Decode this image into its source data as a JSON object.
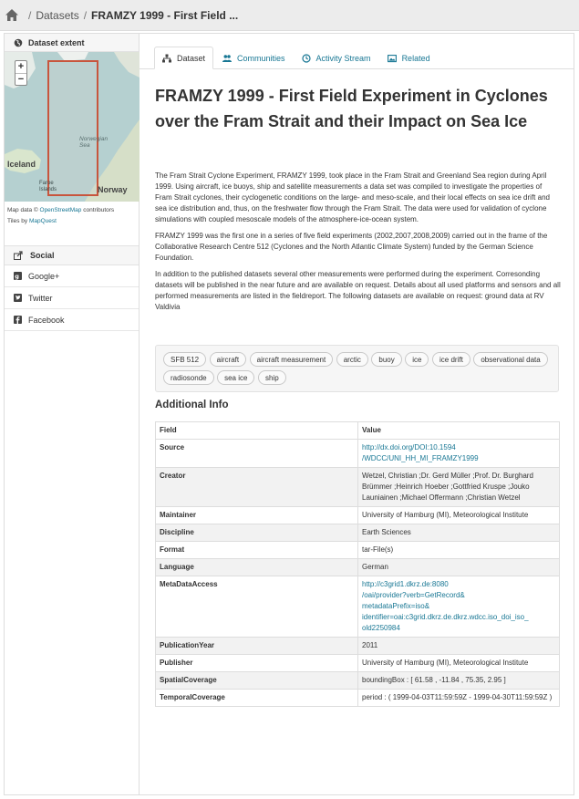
{
  "breadcrumb": {
    "items": [
      "Datasets"
    ],
    "current": "FRAMZY 1999 - First Field ..."
  },
  "sidebar": {
    "extent_title": "Dataset extent",
    "map": {
      "zoom_in": "+",
      "zoom_out": "−",
      "labels": {
        "iceland": "Iceland",
        "norway": "Norway",
        "faroe": "Faroe Islands",
        "sea": "Norwegian Sea"
      },
      "attribution_prefix": "Map data ©",
      "attribution_link": "OpenStreetMap",
      "attribution_suffix": "contributors",
      "tiles_prefix": "Tiles by",
      "tiles_link": "MapQuest"
    },
    "social_title": "Social",
    "social_items": [
      "Google+",
      "Twitter",
      "Facebook"
    ]
  },
  "tabs": [
    "Dataset",
    "Communities",
    "Activity Stream",
    "Related"
  ],
  "dataset": {
    "title": "FRAMZY 1999 - First Field Experiment in Cyclones over the Fram Strait and their Impact on Sea Ice",
    "paragraphs": [
      "The Fram Strait Cyclone Experiment, FRAMZY 1999, took place in the Fram Strait and Greenland Sea region during April 1999. Using aircraft, ice buoys, ship and satellite measurements a data set was compiled to investigate the properties of Fram Strait cyclones, their cyclogenetic conditions on the large- and meso-scale, and their local effects on sea ice drift and sea ice distribution and, thus, on the freshwater flow through the Fram Strait. The data were used for validation of cyclone simulations with coupled mesoscale models of the atmosphere-ice-ocean system.",
      "FRAMZY 1999 was the first one in a series of five field experiments (2002,2007,2008,2009) carried out in the frame of the Collaborative Research Centre 512 (Cyclones and the North Atlantic Climate System) funded by the German Science Foundation.",
      "In addition to the published datasets several other measurements were performed during the experiment. Corresonding datasets will be published in the near future and are available on request. Details about all used platforms and sensors and all performed measurements are listed in the fieldreport. The following datasets are available on request: ground data at RV Valdivia"
    ],
    "tags": [
      "SFB 512",
      "aircraft",
      "aircraft measurement",
      "arctic",
      "buoy",
      "ice",
      "ice drift",
      "observational data",
      "radiosonde",
      "sea ice",
      "ship"
    ]
  },
  "additional_info": {
    "heading": "Additional Info",
    "col_field": "Field",
    "col_value": "Value",
    "rows": [
      {
        "field": "Source",
        "value": "http://dx.doi.org/DOI:10.1594/WDCC/UNI_HH_MI_FRAMZY1999",
        "line1": "http://dx.doi.org/DOI:10.1594",
        "line2": "/WDCC/UNI_HH_MI_FRAMZY1999"
      },
      {
        "field": "Creator",
        "value": "Wetzel, Christian ;Dr. Gerd Müller ;Prof. Dr. Burghard Brümmer ;Heinrich Hoeber ;Gottfried Kruspe ;Jouko Launiainen ;Michael Offermann ;Christian Wetzel"
      },
      {
        "field": "Maintainer",
        "value": "University of Hamburg (MI), Meteorological Institute"
      },
      {
        "field": "Discipline",
        "value": "Earth Sciences"
      },
      {
        "field": "Format",
        "value": "tar-File(s)"
      },
      {
        "field": "Language",
        "value": "German"
      },
      {
        "field": "MetaDataAccess",
        "value": "http://c3grid1.dkrz.de:8080/oai/provider?verb=GetRecord&metadataPrefix=iso&identifier=oai:c3grid.dkrz.de.dkrz.wdcc.iso_doi_iso_old2250984",
        "line1": "http://c3grid1.dkrz.de:8080",
        "line2": "/oai/provider?verb=GetRecord&",
        "line3": "metadataPrefix=iso&",
        "line4": "identifier=oai:c3grid.dkrz.de.dkrz.wdcc.iso_doi_iso_",
        "line5": "old2250984"
      },
      {
        "field": "PublicationYear",
        "value": "2011"
      },
      {
        "field": "Publisher",
        "value": "University of Hamburg (MI), Meteorological Institute"
      },
      {
        "field": "SpatialCoverage",
        "value": "boundingBox : [ 61.58 , -11.84 , 75.35, 2.95 ]"
      },
      {
        "field": "TemporalCoverage",
        "value": "period : ( 1999-04-03T11:59:59Z - 1999-04-30T11:59:59Z )"
      }
    ]
  },
  "colors": {
    "link": "#187794",
    "extent_box": "#c8553d",
    "map_water": "#b5d0d0"
  }
}
